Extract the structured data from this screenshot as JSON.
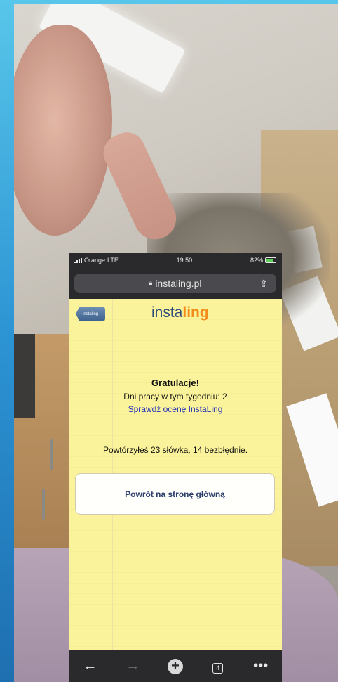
{
  "status_bar": {
    "carrier": "Orange",
    "network": "LTE",
    "time": "19:50",
    "battery": "82%"
  },
  "browser": {
    "url": "instaling.pl",
    "tab_count": "4",
    "icons": {
      "lock": "lock-icon",
      "share": "share-icon",
      "back": "back-arrow-icon",
      "forward": "forward-arrow-icon",
      "new_tab": "plus-icon",
      "tabs": "tabs-icon",
      "more": "more-icon"
    }
  },
  "page": {
    "back_button_label": "instaling",
    "logo_part1": "insta",
    "logo_part2": "ling",
    "congrats_title": "Gratulacje!",
    "days_line": "Dni pracy w tym tygodniu: 2",
    "check_link": "Sprawdź ocenę InstaLing",
    "summary": "Powtórzyłeś 23 słówka, 14 bezbłędnie.",
    "home_button": "Powrót na stronę główną"
  },
  "colors": {
    "page_background": "#fbf39b",
    "link": "#1f2fb8",
    "logo_blue": "#2f4b7a",
    "logo_orange": "#f28c1a",
    "browser_chrome": "#2a2a2c"
  }
}
